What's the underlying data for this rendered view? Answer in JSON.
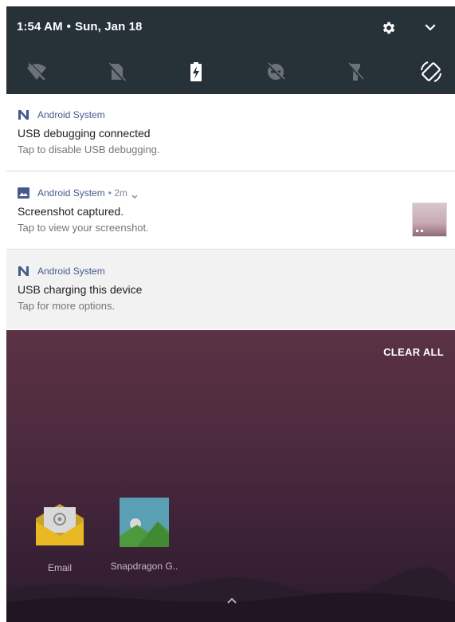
{
  "status_bar": {
    "time": "1:54 AM",
    "separator": "•",
    "date": "Sun, Jan 18",
    "icons": [
      "gear-icon",
      "chevron-down-icon"
    ]
  },
  "quick_settings": {
    "tiles": [
      {
        "name": "wifi-off-icon"
      },
      {
        "name": "no-sim-icon"
      },
      {
        "name": "battery-charging-icon"
      },
      {
        "name": "do-not-disturb-off-icon"
      },
      {
        "name": "flashlight-off-icon"
      },
      {
        "name": "auto-rotate-icon"
      }
    ]
  },
  "notifications": [
    {
      "app": "Android System",
      "title": "USB debugging connected",
      "text": "Tap to disable USB debugging.",
      "icon": "android-n-icon"
    },
    {
      "app": "Android System",
      "meta": "• 2m",
      "title": "Screenshot captured.",
      "text": "Tap to view your screenshot.",
      "icon": "image-icon"
    },
    {
      "app": "Android System",
      "title": "USB charging this device",
      "text": "Tap for more options.",
      "icon": "android-n-icon"
    }
  ],
  "clear_all": "CLEAR ALL",
  "home": {
    "apps": [
      {
        "label": "Email",
        "icon": "email-app-icon"
      },
      {
        "label": "Snapdragon G..",
        "icon": "gallery-app-icon"
      }
    ]
  },
  "colors": {
    "shade_bg": "#263238",
    "notif_accent": "#455a8c",
    "wallpaper_top": "#5a3243",
    "wallpaper_bottom": "#2c1a2d"
  }
}
